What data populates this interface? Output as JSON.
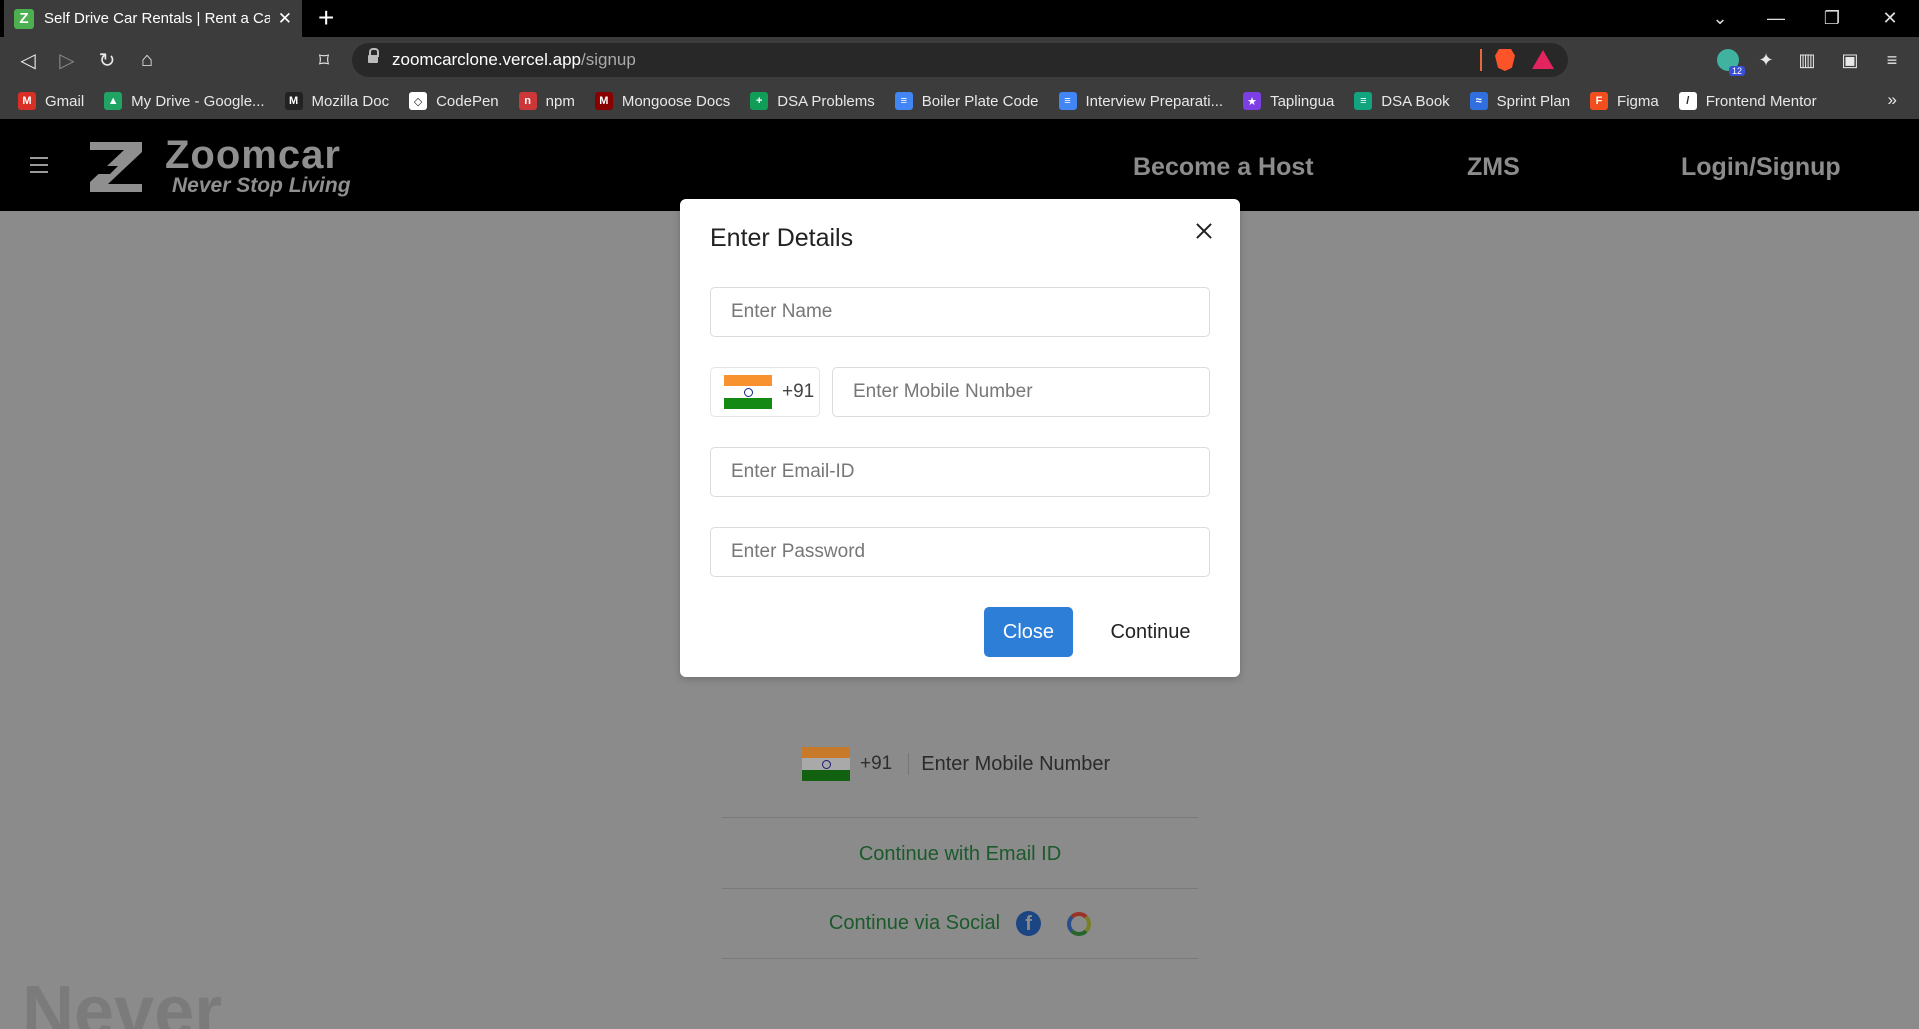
{
  "browser": {
    "tab_title": "Self Drive Car Rentals | Rent a Car",
    "tab_favicon_letter": "Z",
    "new_tab": "+",
    "url_host": "zoomcarclone.vercel.app",
    "url_path": "/signup",
    "extension_badge": "12",
    "bookmarks": [
      {
        "label": "Gmail",
        "icon": "gmail-icon",
        "color": "#d93025",
        "glyph": "M"
      },
      {
        "label": "My Drive - Google...",
        "icon": "google-drive-icon",
        "color": "#1fa463",
        "glyph": "▲"
      },
      {
        "label": "Mozilla Doc",
        "icon": "mdn-icon",
        "color": "#222222",
        "glyph": "M"
      },
      {
        "label": "CodePen",
        "icon": "codepen-icon",
        "color": "#ffffff",
        "glyph": "◇"
      },
      {
        "label": "npm",
        "icon": "npm-icon",
        "color": "#cb3837",
        "glyph": "n"
      },
      {
        "label": "Mongoose Docs",
        "icon": "mongoose-icon",
        "color": "#880000",
        "glyph": "M"
      },
      {
        "label": "DSA Problems",
        "icon": "sheets-icon",
        "color": "#0f9d58",
        "glyph": "+"
      },
      {
        "label": "Boiler Plate Code",
        "icon": "docs-icon",
        "color": "#4285f4",
        "glyph": "≡"
      },
      {
        "label": "Interview Preparati...",
        "icon": "docs-icon",
        "color": "#4285f4",
        "glyph": "≡"
      },
      {
        "label": "Taplingua",
        "icon": "star-icon",
        "color": "#7b3fe4",
        "glyph": "★"
      },
      {
        "label": "DSA Book",
        "icon": "book-icon",
        "color": "#12a37f",
        "glyph": "≡"
      },
      {
        "label": "Sprint Plan",
        "icon": "sprint-icon",
        "color": "#2f6fe0",
        "glyph": "≈"
      },
      {
        "label": "Figma",
        "icon": "figma-icon",
        "color": "#f24e1e",
        "glyph": "F"
      },
      {
        "label": "Frontend Mentor",
        "icon": "frontend-mentor-icon",
        "color": "#ffffff",
        "glyph": "/"
      }
    ],
    "bookmarks_more": "»"
  },
  "header": {
    "logo_word": "Zoomcar",
    "logo_tagline": "Never Stop Living",
    "nav": [
      "Become a Host",
      "ZMS",
      "Login/Signup"
    ]
  },
  "background_form": {
    "country_code": "+91",
    "mobile_placeholder": "Enter Mobile Number",
    "email_link": "Continue with Email ID",
    "social_label": "Continue via Social",
    "hero_word": "Never"
  },
  "modal": {
    "title": "Enter Details",
    "name_placeholder": "Enter Name",
    "country_code": "+91",
    "mobile_placeholder": "Enter Mobile Number",
    "email_placeholder": "Enter Email-ID",
    "password_placeholder": "Enter Password",
    "close_label": "Close",
    "continue_label": "Continue"
  },
  "colors": {
    "primary_button": "#2c7ed6",
    "link_green": "#1b5a2b",
    "header_bg": "#000000"
  }
}
